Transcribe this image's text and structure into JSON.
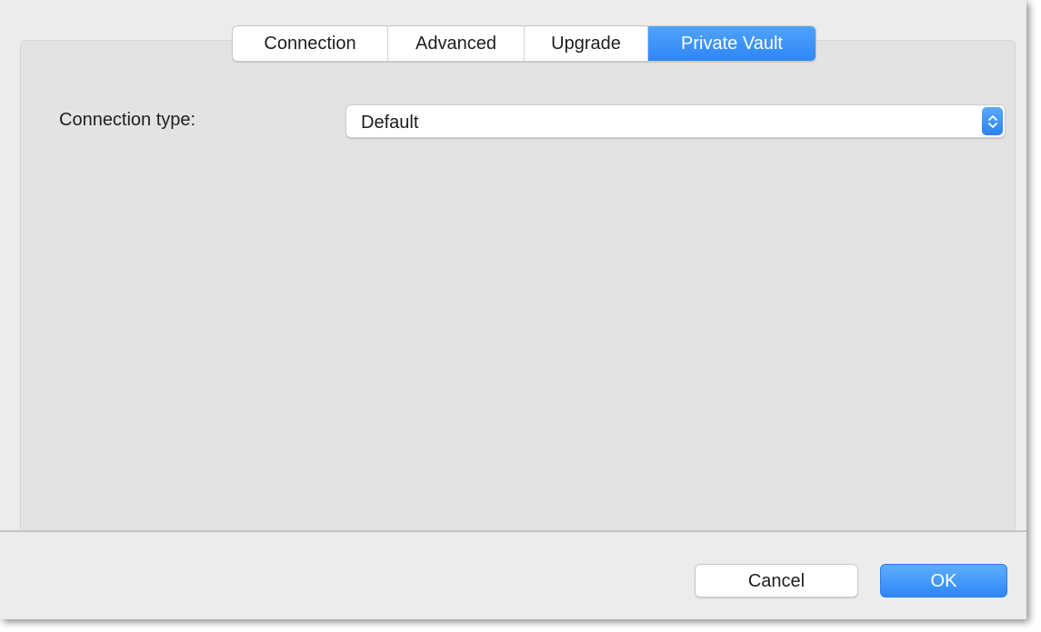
{
  "tabs": [
    {
      "label": "Connection",
      "active": false
    },
    {
      "label": "Advanced",
      "active": false
    },
    {
      "label": "Upgrade",
      "active": false
    },
    {
      "label": "Private Vault",
      "active": true
    }
  ],
  "form": {
    "connection_type_label": "Connection type:",
    "connection_type_value": "Default"
  },
  "buttons": {
    "cancel_label": "Cancel",
    "ok_label": "OK"
  },
  "icons": {
    "select_stepper": "chevron-up-down-icon"
  },
  "colors": {
    "accent": "#2f86f6",
    "window_bg": "#ececec",
    "panel_bg": "#e3e3e3"
  }
}
